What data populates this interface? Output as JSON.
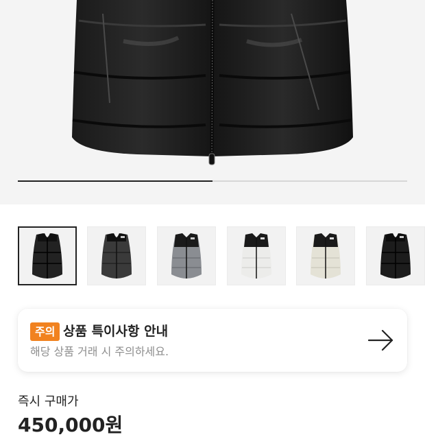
{
  "gallery": {
    "progress_fraction": 0.5,
    "thumbnails": [
      {
        "name": "black-glossy",
        "selected": true
      },
      {
        "name": "dark-gray"
      },
      {
        "name": "gray"
      },
      {
        "name": "white-black"
      },
      {
        "name": "cream-black"
      },
      {
        "name": "black"
      }
    ]
  },
  "notice": {
    "badge": "주의",
    "title": "상품 특이사항 안내",
    "subtitle": "해당 상품 거래 시 주의하세요.",
    "arrow_icon": "arrow-right-icon"
  },
  "purchase": {
    "label": "즉시 구매가",
    "price": "450,000원"
  },
  "colors": {
    "accent": "#f1821f",
    "text": "#222222",
    "muted": "#8e8e8e"
  }
}
